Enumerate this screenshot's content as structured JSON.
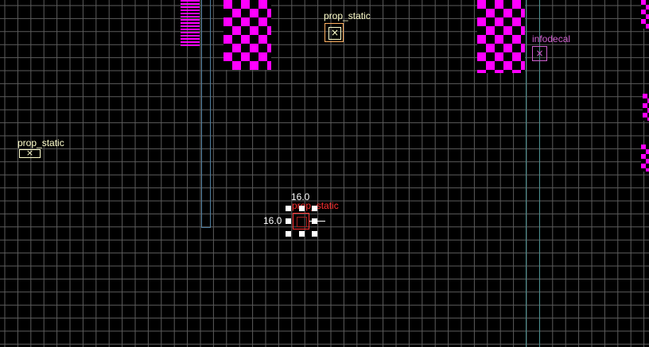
{
  "viewport": {
    "name": "2D editor viewport",
    "background": "#000000",
    "grid_color": "#5c5c5c"
  },
  "colors": {
    "prop_label": "#ffffcc",
    "infodecal": "#d060d0",
    "selected": "#ff3030",
    "checker_a": "#ff00ff",
    "checker_b": "#000000",
    "brush_blue": "#4f7fa0",
    "brush_teal": "#4a8f8f"
  },
  "entities": {
    "prop_static_top": {
      "label": "prop_static",
      "icon": "x-box-icon"
    },
    "infodecal": {
      "label": "infodecal",
      "icon": "x-box-icon"
    },
    "prop_static_left": {
      "label": "prop_static",
      "icon": "x-box-icon"
    },
    "selected_prop": {
      "label": "prop_static",
      "icon": "selected-box-icon"
    }
  },
  "selection": {
    "width_readout": "16.0",
    "height_readout": "16.0"
  }
}
